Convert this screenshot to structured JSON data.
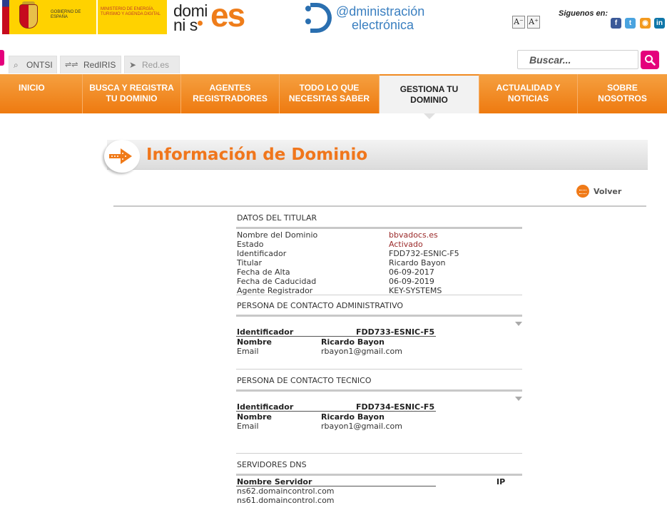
{
  "header": {
    "gobierno": "GOBIERNO DE ESPAÑA",
    "ministerio": "MINISTERIO DE ENERGÍA, TURISMO Y AGENDA DIGITAL",
    "dominios_line1": "domi",
    "dominios_line2": "ni s",
    "dominios_es": "es",
    "admin_line1": "@dministración",
    "admin_line2": "electrónica",
    "font_minus": "A⁻",
    "font_plus": "A⁺",
    "siguenos": "Siguenos en:",
    "social": [
      "f",
      "t",
      "◉",
      "in"
    ]
  },
  "site_tabs": [
    {
      "label": "ONTSI",
      "icon": "search-icon"
    },
    {
      "label": "RedIRIS",
      "icon": "network-icon"
    },
    {
      "label": "Red.es",
      "icon": "pointer-icon"
    }
  ],
  "search": {
    "placeholder": "Buscar..."
  },
  "nav": [
    {
      "line1": "INICIO",
      "line2": ""
    },
    {
      "line1": "BUSCA Y REGISTRA",
      "line2": "TU DOMINIO"
    },
    {
      "line1": "AGENTES",
      "line2": "REGISTRADORES"
    },
    {
      "line1": "TODO LO QUE",
      "line2": "NECESITAS SABER"
    },
    {
      "line1": "GESTIONA TU",
      "line2": "DOMINIO"
    },
    {
      "line1": "ACTUALIDAD Y",
      "line2": "NOTICIAS"
    },
    {
      "line1": "SOBRE",
      "line2": "NOSOTROS"
    }
  ],
  "page_title": "Información de Dominio",
  "volver": "Volver",
  "titular": {
    "title": "DATOS DEL TITULAR",
    "rows": [
      {
        "label": "Nombre del Dominio",
        "value": "bbvadocs.es"
      },
      {
        "label": "Estado",
        "value": "Activado"
      },
      {
        "label": "Identificador",
        "value": "FDD732-ESNIC-F5"
      },
      {
        "label": "Titular",
        "value": "Ricardo Bayon"
      },
      {
        "label": "Fecha de Alta",
        "value": "06-09-2017"
      },
      {
        "label": "Fecha de Caducidad",
        "value": "06-09-2019"
      },
      {
        "label": "Agente Registrador",
        "value": "KEY-SYSTEMS"
      }
    ]
  },
  "admin_contact": {
    "title": "PERSONA DE CONTACTO ADMINISTRATIVO",
    "id_label": "Identificador",
    "id_value": "FDD733-ESNIC-F5",
    "name_label": "Nombre",
    "name_value": "Ricardo Bayon",
    "email_label": "Email",
    "email_value": "rbayon1@gmail.com"
  },
  "tech_contact": {
    "title": "PERSONA DE CONTACTO TECNICO",
    "id_label": "Identificador",
    "id_value": "FDD734-ESNIC-F5",
    "name_label": "Nombre",
    "name_value": "Ricardo Bayon",
    "email_label": "Email",
    "email_value": "rbayon1@gmail.com"
  },
  "dns": {
    "title": "SERVIDORES DNS",
    "col_server": "Nombre Servidor",
    "col_ip": "IP",
    "servers": [
      "ns62.domaincontrol.com",
      "ns61.domaincontrol.com"
    ]
  },
  "colors": {
    "orange": "#f08a20",
    "pink": "#e4007c",
    "title_orange": "#f0761c",
    "link_red": "#9b2a2a"
  }
}
